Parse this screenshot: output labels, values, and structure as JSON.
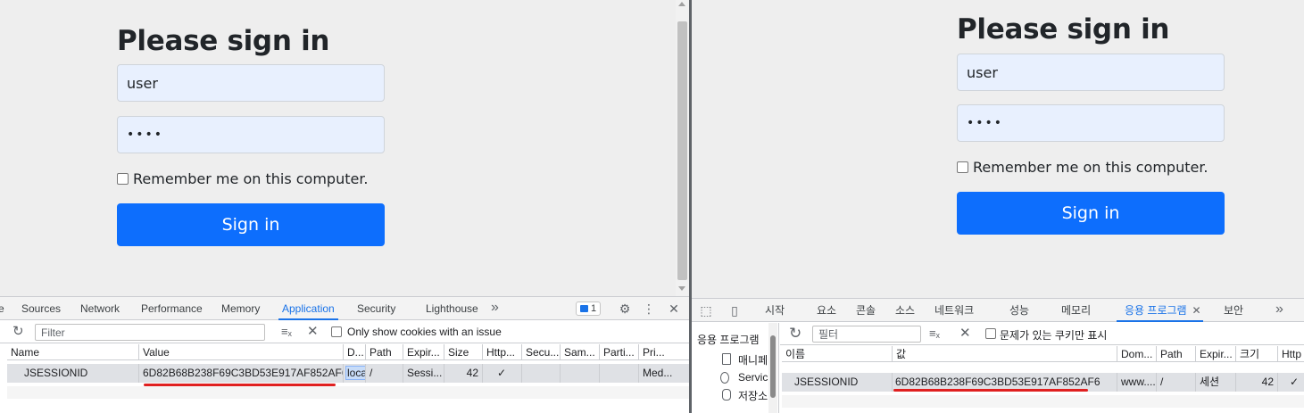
{
  "login": {
    "title": "Please sign in",
    "username_value": "user",
    "password_masked": "••••",
    "remember_label": "Remember me on this computer.",
    "signin_label": "Sign in"
  },
  "devtools_en": {
    "tabs": [
      "e",
      "Sources",
      "Network",
      "Performance",
      "Memory",
      "Application",
      "Security",
      "Lighthouse"
    ],
    "active_tab": "Application",
    "more_tabs": "»",
    "issue_count": "1",
    "filter_placeholder": "Filter",
    "only_issue_label": "Only show cookies with an issue",
    "columns": [
      "Name",
      "Value",
      "D...",
      "Path",
      "Expir...",
      "Size",
      "Http...",
      "Secu...",
      "Sam...",
      "Parti...",
      "Pri..."
    ],
    "row": {
      "name": "JSESSIONID",
      "value": "6D82B68B238F69C3BD53E917AF852AF6",
      "domain": "loca",
      "path": "/",
      "expires": "Sessi...",
      "size": "42",
      "http": "✓",
      "priority": "Med..."
    }
  },
  "devtools_ko": {
    "tabs": [
      "시작",
      "요소",
      "콘솔",
      "소스",
      "네트워크",
      "성능",
      "메모리",
      "응용 프로그램",
      "보안"
    ],
    "active_tab": "응용 프로그램",
    "more_tabs": "»",
    "sidebar_header": "응용 프로그램",
    "sidebar_items": [
      "매니페",
      "Servic",
      "저장소"
    ],
    "filter_placeholder": "필터",
    "only_issue_label": "문제가 있는 쿠키만 표시",
    "columns": [
      "이름",
      "값",
      "Dom...",
      "Path",
      "Expir...",
      "크기",
      "Http"
    ],
    "row": {
      "name": "JSESSIONID",
      "value": "6D82B68B238F69C3BD53E917AF852AF6",
      "domain": "www....",
      "path": "/",
      "expires": "세션",
      "size": "42",
      "http": "✓"
    }
  },
  "colors": {
    "accent": "#1a73e8",
    "signin_button": "#0d6efd",
    "highlight_underline": "#e02020",
    "page_background": "#eeeeee"
  }
}
